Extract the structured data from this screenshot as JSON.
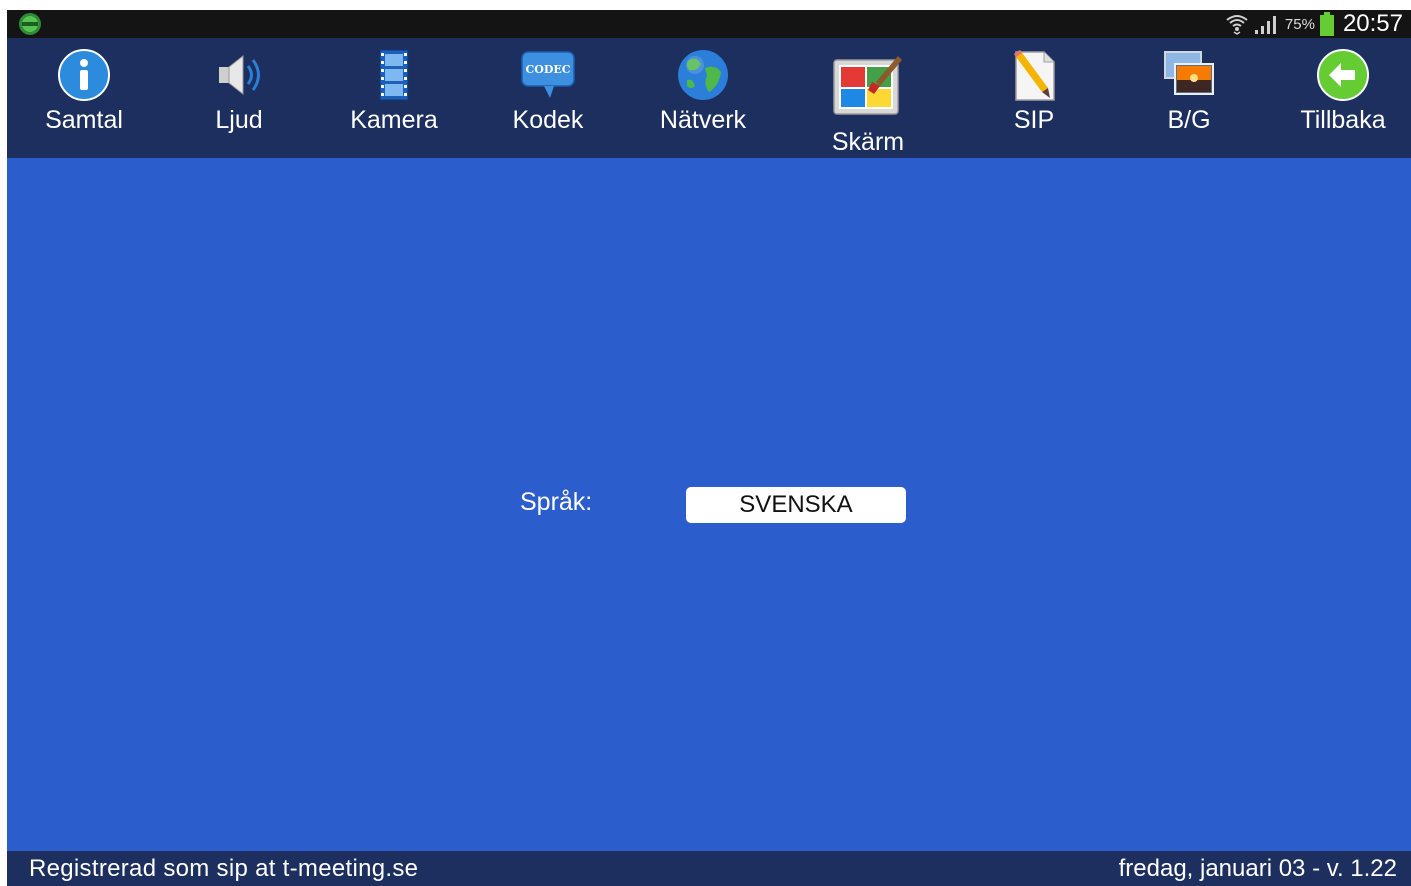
{
  "status_bar": {
    "battery_percent": "75%",
    "time": "20:57",
    "icons": [
      "tmeeting-app-icon",
      "wifi-icon",
      "signal-icon",
      "battery-icon"
    ]
  },
  "toolbar": {
    "items": [
      {
        "label": "Samtal",
        "icon": "info-icon"
      },
      {
        "label": "Ljud",
        "icon": "speaker-icon"
      },
      {
        "label": "Kamera",
        "icon": "film-strip-icon"
      },
      {
        "label": "Kodek",
        "icon": "codec-bubble-icon",
        "icon_text": "CODEC"
      },
      {
        "label": "Nätverk",
        "icon": "globe-icon"
      },
      {
        "label": "Skärm",
        "icon": "display-paint-icon",
        "active": true
      },
      {
        "label": "SIP",
        "icon": "document-pencil-icon"
      },
      {
        "label": "B/G",
        "icon": "background-images-icon"
      },
      {
        "label": "Tillbaka",
        "icon": "back-arrow-icon"
      }
    ]
  },
  "settings": {
    "language_label": "Språk:",
    "language_value": "SVENSKA"
  },
  "footer": {
    "registration": "Registrerad som sip at t-meeting.se",
    "date_version": "fredag, januari 03 - v. 1.22"
  },
  "colors": {
    "content_background": "#2b5ecc",
    "toolbar_background": "#1c2f5f",
    "status_bar_background": "#141414"
  }
}
